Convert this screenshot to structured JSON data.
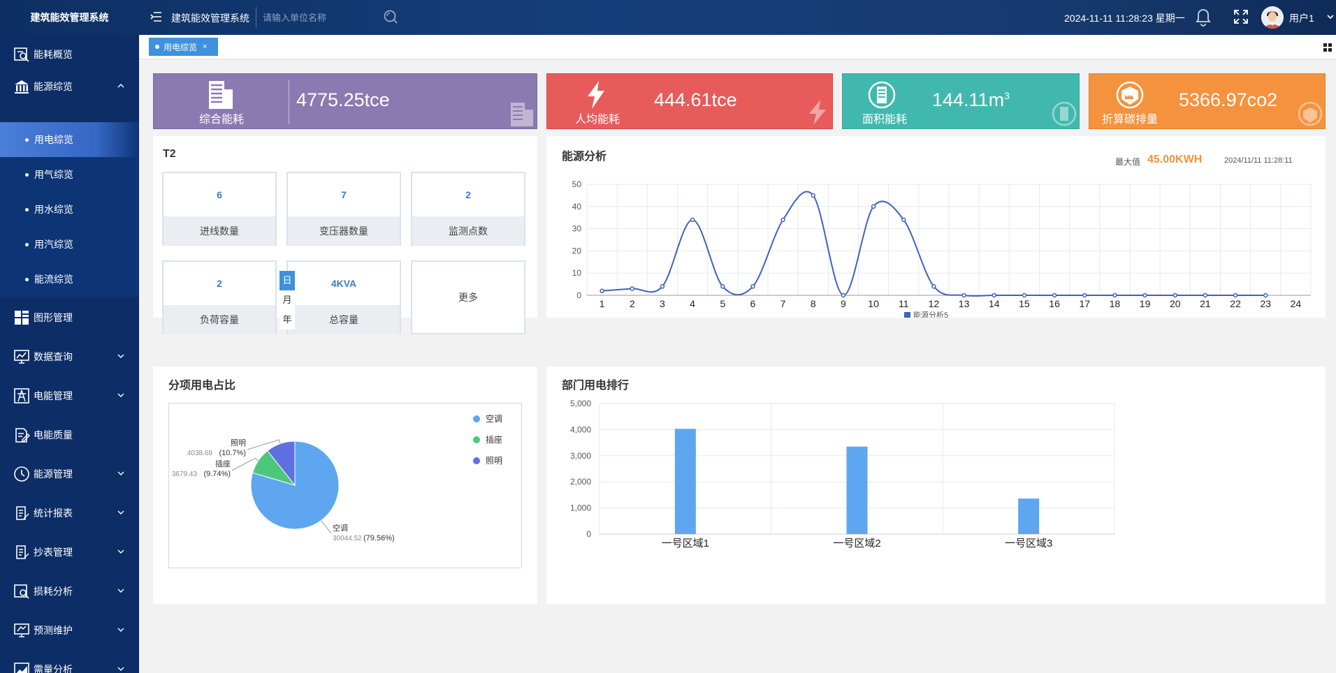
{
  "app": {
    "title": "建筑能效管理系统",
    "system_name": "建筑能效管理系统",
    "search_placeholder": "请输入单位名称",
    "datetime": "2024-11-11 11:28:23 星期一",
    "user": "用户1"
  },
  "sidebar": {
    "items": [
      {
        "label": "能耗概览",
        "icon": "magnifier-chart-icon"
      },
      {
        "label": "能源综览",
        "icon": "building-columns-icon"
      },
      {
        "label": "图形管理",
        "icon": "grid-icon"
      },
      {
        "label": "数据查询",
        "icon": "monitor-chart-icon"
      },
      {
        "label": "电能管理",
        "icon": "tower-icon"
      },
      {
        "label": "电能质量",
        "icon": "document-pen-icon"
      },
      {
        "label": "能源管理",
        "icon": "clock-icon"
      },
      {
        "label": "统计报表",
        "icon": "report-icon"
      },
      {
        "label": "抄表管理",
        "icon": "reading-icon"
      },
      {
        "label": "损耗分析",
        "icon": "search-chart-icon"
      },
      {
        "label": "预测维护",
        "icon": "monitor-icon"
      },
      {
        "label": "需量分析",
        "icon": "area-chart-icon"
      }
    ],
    "subitems": [
      "用电综览",
      "用气综览",
      "用水综览",
      "用汽综览",
      "能流综览"
    ],
    "active_sub": "用电综览"
  },
  "tabs": {
    "active": "用电综览",
    "close": "×"
  },
  "date_buttons": [
    "日",
    "月",
    "年"
  ],
  "kpis": [
    {
      "label": "综合能耗",
      "value": "4775.25tce",
      "color": "#8b7ab1"
    },
    {
      "label": "人均能耗",
      "value": "444.61tce",
      "color": "#e75b5b"
    },
    {
      "label": "面积能耗",
      "value": "144.11m",
      "sup": "3",
      "color": "#41b8ae"
    },
    {
      "label": "折算碳排量",
      "value": "5366.97co2",
      "color": "#f5923e"
    }
  ],
  "t2": {
    "title": "T2",
    "cards": [
      {
        "num": "6",
        "label": "进线数量"
      },
      {
        "num": "7",
        "label": "变压器数量"
      },
      {
        "num": "2",
        "label": "监测点数"
      },
      {
        "num": "2",
        "label": "负荷容量"
      },
      {
        "num": "4KVA",
        "label": "总容量"
      }
    ],
    "more": "更多"
  },
  "energy": {
    "title": "能源分析",
    "max_label": "最大值",
    "max_value": "45.00KWH",
    "timestamp": "2024/11/11 11:28:11"
  },
  "pie": {
    "title": "分项用电占比"
  },
  "dept": {
    "title": "部门用电排行"
  },
  "chart_data": [
    {
      "type": "line",
      "title": "能源分析",
      "x": [
        1,
        2,
        3,
        4,
        5,
        6,
        7,
        8,
        9,
        10,
        11,
        12,
        13,
        14,
        15,
        16,
        17,
        18,
        19,
        20,
        21,
        22,
        23,
        24
      ],
      "series": [
        {
          "name": "能源分析5",
          "values": [
            2,
            3,
            4,
            34,
            4,
            4,
            34,
            45,
            0,
            40,
            34,
            4,
            0,
            0,
            0,
            0,
            0,
            0,
            0,
            0,
            0,
            0,
            0,
            null
          ]
        }
      ],
      "ylim": [
        0,
        50
      ],
      "yticks": [
        0,
        10,
        20,
        30,
        40,
        50
      ],
      "grid": true,
      "legend": "bottom",
      "color": "#3e63b8"
    },
    {
      "type": "pie",
      "title": "分项用电占比",
      "slices": [
        {
          "name": "空调",
          "value": 30044.52,
          "percent": "79.56%",
          "color": "#5ea6ef"
        },
        {
          "name": "插座",
          "value": 3679.43,
          "percent": "9.74%",
          "color": "#4fc77a"
        },
        {
          "name": "照明",
          "value": 4038.69,
          "percent": "10.7%",
          "color": "#5f70e0"
        }
      ],
      "legend": "top-right"
    },
    {
      "type": "bar",
      "title": "部门用电排行",
      "categories": [
        "一号区域1",
        "一号区域2",
        "一号区域3"
      ],
      "values": [
        4030,
        3350,
        1360
      ],
      "ylim": [
        0,
        5000
      ],
      "yticks": [
        "0",
        "1,000",
        "2,000",
        "3,000",
        "4,000",
        "5,000"
      ],
      "color": "#5ea6ef",
      "grid": true
    }
  ]
}
